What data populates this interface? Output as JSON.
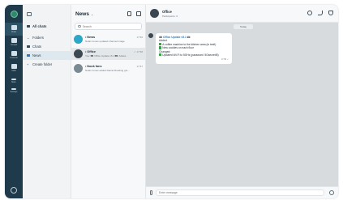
{
  "rail": {
    "items": [
      {
        "label": "Chats"
      },
      {
        "label": "Unread"
      },
      {
        "label": "Contacts"
      },
      {
        "label": "Calls"
      },
      {
        "label": "More"
      },
      {
        "label": "Settings"
      }
    ]
  },
  "folders": {
    "all_chats": "All chats",
    "items": [
      {
        "label": "Folders"
      },
      {
        "label": "Chats"
      },
      {
        "label": "News"
      },
      {
        "label": "Create folder"
      }
    ]
  },
  "chatlist": {
    "title": "News",
    "search_placeholder": "Search",
    "chats": [
      {
        "name": "News",
        "time": "17:56",
        "preview": "Nolan Jones updated channel image"
      },
      {
        "name": "Office",
        "time": "17:58",
        "preview": "You: 📼 Office Update v5.1 📼 Added..."
      },
      {
        "name": "Nook fans",
        "time": "17:57",
        "preview": "Nolan Jones added Daniel Roeding got..."
      }
    ]
  },
  "conversation": {
    "title": "Office",
    "subtitle": "Participants: 9",
    "date_chip": "Today",
    "message": {
      "header": "📼 Office Update v5.1 📼",
      "lines": [
        "Added:",
        "A coffee machine to the kitchen area (in test!)",
        "New cookies on each floor",
        "Changed:",
        "Updated Wi-Fi to 5GHz (password: 5Gsecret!8)"
      ],
      "checked_lines": [
        1,
        2,
        4
      ],
      "time": "17:58"
    }
  },
  "composer": {
    "placeholder": "Enter message"
  },
  "colors": {
    "rail": "#1f3a4a",
    "accent": "#3378b5",
    "check": "#3aa14a"
  }
}
